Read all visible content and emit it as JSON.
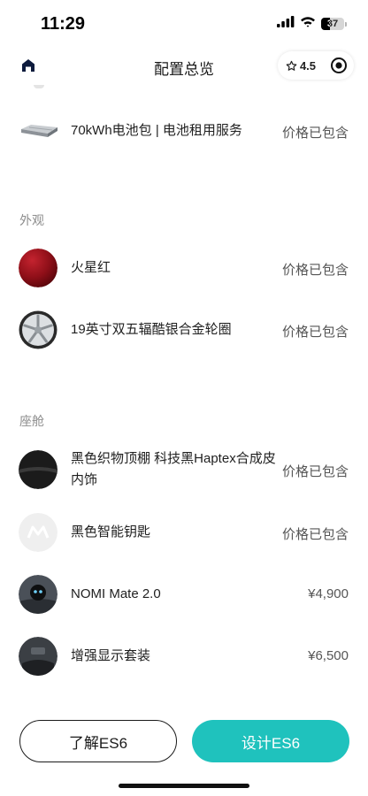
{
  "status_bar": {
    "time": "11:29",
    "battery_level": "37"
  },
  "nav": {
    "title": "配置总览",
    "rating": "4.5"
  },
  "items_top": [
    {
      "name": "70kWh电池包 | 电池租用服务",
      "price": "价格已包含",
      "thumb": "battery-pack"
    }
  ],
  "sections": [
    {
      "label": "外观",
      "items": [
        {
          "name": "火星红",
          "price": "价格已包含",
          "thumb": "red-paint-swatch"
        },
        {
          "name": "19英寸双五辐酷银合金轮圈",
          "price": "价格已包含",
          "thumb": "alloy-wheel"
        }
      ]
    },
    {
      "label": "座舱",
      "items": [
        {
          "name": "黑色织物顶棚 科技黑Haptex合成皮内饰",
          "price": "价格已包含",
          "thumb": "black-interior"
        },
        {
          "name": "黑色智能钥匙",
          "price": "价格已包含",
          "thumb": "smart-key"
        },
        {
          "name": "NOMI Mate 2.0",
          "price": "¥4,900",
          "thumb": "nomi-device"
        },
        {
          "name": "增强显示套装",
          "price": "¥6,500",
          "thumb": "display-kit"
        }
      ]
    }
  ],
  "bottom": {
    "learn_label": "了解ES6",
    "design_label": "设计ES6"
  },
  "colors": {
    "accent": "#1fc2bd",
    "paint_red": "#8e0f18",
    "text_primary": "#1f1f1f",
    "text_secondary": "#8c8c8c"
  }
}
